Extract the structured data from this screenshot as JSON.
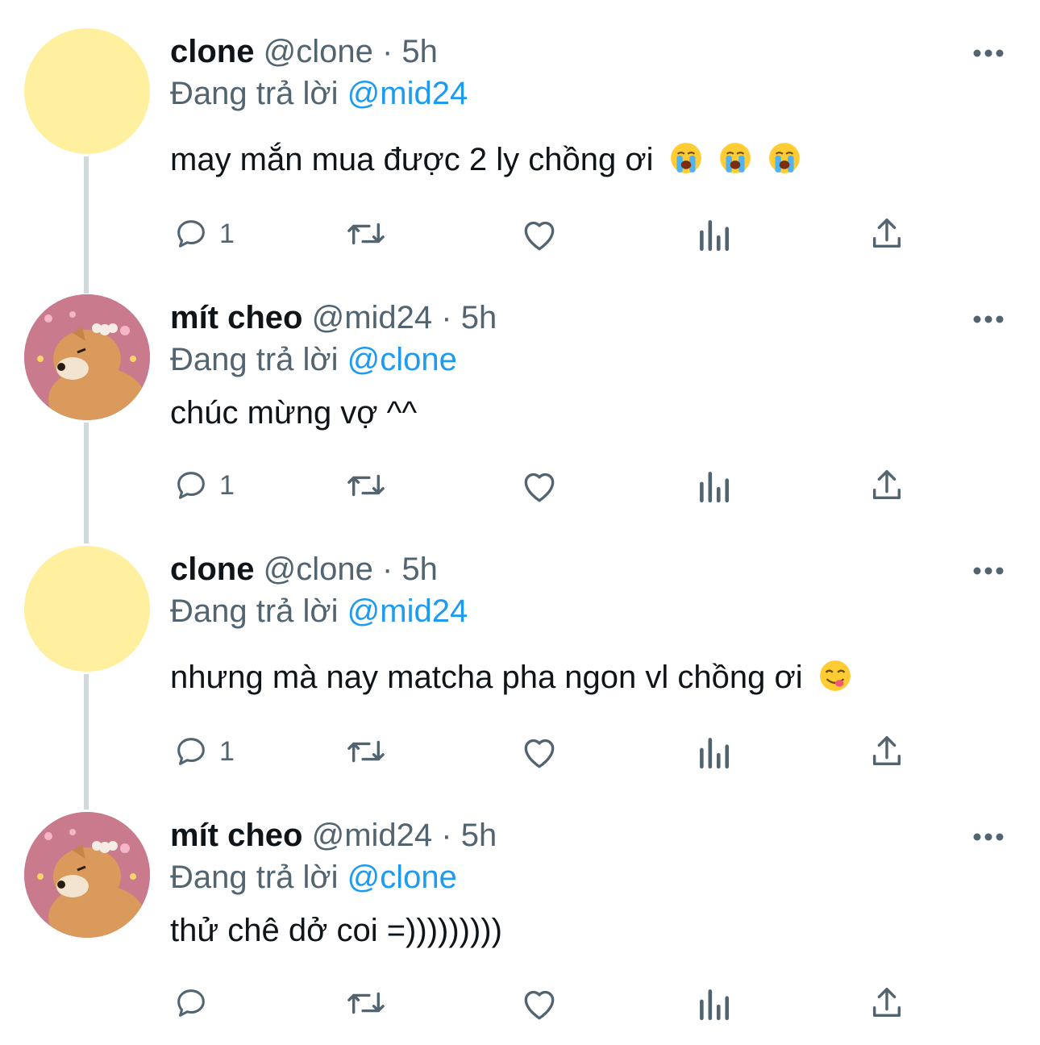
{
  "accent_color": "#1d9bf0",
  "muted_color": "#536471",
  "tweets": [
    {
      "name": "clone",
      "handle": "@clone",
      "separator": "·",
      "time": "5h",
      "reply_prefix": "Đang trả lời",
      "reply_to": "@mid24",
      "text": "may mắn mua được 2 ly chồng ơi",
      "emojis": [
        "loudly-crying-face-emoji",
        "loudly-crying-face-emoji",
        "loudly-crying-face-emoji"
      ],
      "avatar": "yellow-circle-avatar",
      "reply_count": "1"
    },
    {
      "name": "mít cheo",
      "handle": "@mid24",
      "separator": "·",
      "time": "5h",
      "reply_prefix": "Đang trả lời",
      "reply_to": "@clone",
      "text": "chúc mừng vợ ^^",
      "emojis": [],
      "avatar": "shiba-dog-avatar",
      "reply_count": "1"
    },
    {
      "name": "clone",
      "handle": "@clone",
      "separator": "·",
      "time": "5h",
      "reply_prefix": "Đang trả lời",
      "reply_to": "@mid24",
      "text": "nhưng mà nay matcha pha ngon vl chồng ơi",
      "emojis": [
        "yummy-face-emoji"
      ],
      "avatar": "yellow-circle-avatar",
      "reply_count": "1"
    },
    {
      "name": "mít cheo",
      "handle": "@mid24",
      "separator": "·",
      "time": "5h",
      "reply_prefix": "Đang trả lời",
      "reply_to": "@clone",
      "text": "thử chê dở coi =)))))))))",
      "emojis": [],
      "avatar": "shiba-dog-avatar",
      "reply_count": ""
    }
  ],
  "icons": {
    "more": "more-horizontal-icon",
    "reply": "reply-bubble-icon",
    "retweet": "retweet-icon",
    "like": "heart-icon",
    "views": "views-bar-chart-icon",
    "share": "share-upload-icon"
  }
}
